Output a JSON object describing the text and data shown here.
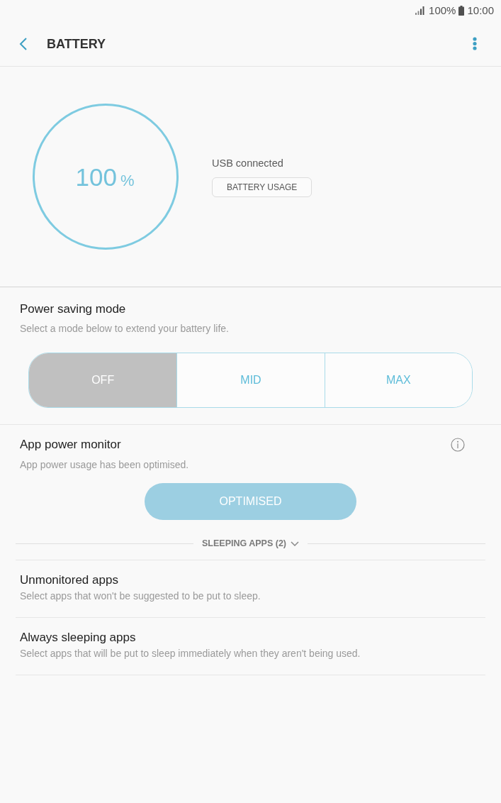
{
  "status_bar": {
    "battery": "100%",
    "time": "10:00"
  },
  "header": {
    "title": "BATTERY"
  },
  "battery": {
    "level": 1,
    "percent": "100",
    "unit": "%",
    "status": "USB connected",
    "button": "BATTERY USAGE"
  },
  "power_saving": {
    "title": "Power saving mode",
    "subtitle": "Select a mode below to extend your battery life.",
    "modes": [
      {
        "label": "OFF",
        "selected": true
      },
      {
        "label": "MID",
        "selected": false
      },
      {
        "label": "MAX",
        "selected": false
      }
    ]
  },
  "app_power_monitor": {
    "title": "App power monitor",
    "subtitle": "App power usage has been optimised.",
    "button": {
      "label": "OPTIMISED",
      "disabled": true
    }
  },
  "sleeping_apps": {
    "label": "SLEEPING APPS (2)",
    "expanded": false
  },
  "settings": [
    {
      "title": "Unmonitored apps",
      "subtitle": "Select apps that won't be suggested to be put to sleep."
    },
    {
      "title": "Always sleeping apps",
      "subtitle": "Select apps that will be put to sleep immediately when they aren't being used."
    }
  ]
}
